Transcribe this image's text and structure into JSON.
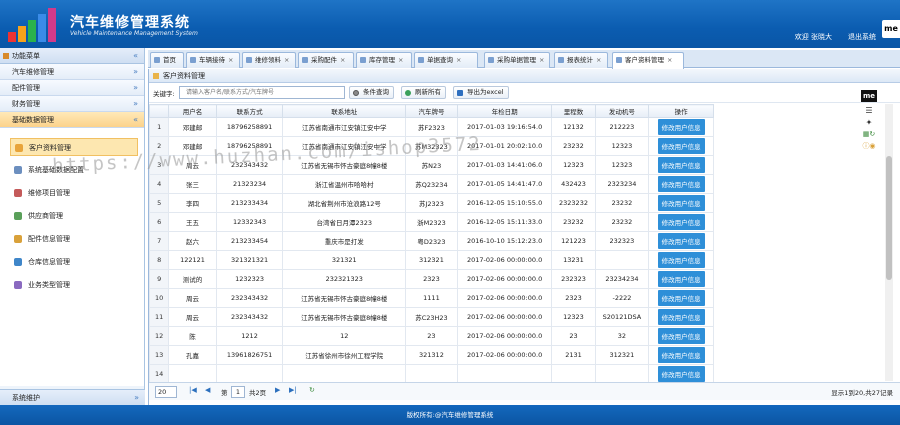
{
  "app": {
    "title": "汽车维修管理系统",
    "subtitle": "Vehicle Maintenance Management System",
    "welcome": "欢迎 张晓大",
    "logout": "退出系统",
    "badge": "me"
  },
  "sidebar": {
    "menu_title": "功能菜单",
    "groups": [
      {
        "label": "汽车维修管理"
      },
      {
        "label": "配件管理"
      },
      {
        "label": "财务管理"
      },
      {
        "label": "基础数据管理"
      }
    ],
    "items": [
      {
        "label": "客户资料管理"
      },
      {
        "label": "系统基础数据配置"
      },
      {
        "label": "维修项目管理"
      },
      {
        "label": "供应商管理"
      },
      {
        "label": "配件信息管理"
      },
      {
        "label": "仓库信息管理"
      },
      {
        "label": "业务类型管理"
      }
    ],
    "bottom": "系统维护"
  },
  "tabs": [
    {
      "label": "首页"
    },
    {
      "label": "车辆接待"
    },
    {
      "label": "维修领料"
    },
    {
      "label": "采购配件"
    },
    {
      "label": "库存管理"
    },
    {
      "label": "单据查询"
    },
    {
      "label": "采购单据管理"
    },
    {
      "label": "报表统计"
    },
    {
      "label": "客户资料管理"
    }
  ],
  "panel": {
    "title": "客户资料管理",
    "keyword_label": "关键字:",
    "keyword_placeholder": "请输入客户名/联系方式/汽车牌号",
    "btn_search": "条件查询",
    "btn_refresh": "刷新所有",
    "btn_export": "导出为excel"
  },
  "table": {
    "headers": [
      "",
      "用户名",
      "联系方式",
      "联系地址",
      "汽车牌号",
      "年检日期",
      "里程数",
      "发动机号",
      "操作"
    ],
    "action_label": "修改用户信息",
    "rows": [
      [
        "1",
        "邓建邮",
        "18796258891",
        "江苏省南通市江安镇江安中学",
        "苏F2323",
        "2017-01-03 19:16:54.0",
        "12132",
        "212223"
      ],
      [
        "2",
        "邓建邮",
        "18796258891",
        "江苏省南通市江安镇江安中学",
        "苏M32323",
        "2017-01-01 20:02:10.0",
        "23232",
        "12323"
      ],
      [
        "3",
        "周云",
        "232343432",
        "江苏省无锡市怀古豪庭8幢8楼",
        "苏N23",
        "2017-01-03 14:41:06.0",
        "12323",
        "12323"
      ],
      [
        "4",
        "张三",
        "21323234",
        "浙江省温州市哈哈村",
        "苏Q23234",
        "2017-01-05 14:41:47.0",
        "432423",
        "2323234"
      ],
      [
        "5",
        "李四",
        "213233434",
        "湖北省荆州市沧浪路12号",
        "苏J2323",
        "2016-12-05 15:10:55.0",
        "2323232",
        "23232"
      ],
      [
        "6",
        "王五",
        "12332343",
        "台湾省日月潭2323",
        "浙M2323",
        "2016-12-05 15:11:33.0",
        "23232",
        "23232"
      ],
      [
        "7",
        "赵六",
        "213233454",
        "重庆市是打发",
        "粤D2323",
        "2016-10-10 15:12:23.0",
        "121223",
        "232323"
      ],
      [
        "8",
        "122121",
        "321321321",
        "321321",
        "312321",
        "2017-02-06 00:00:00.0",
        "13231",
        ""
      ],
      [
        "9",
        "测试的",
        "1232323",
        "232321323",
        "2323",
        "2017-02-06 00:00:00.0",
        "232323",
        "23234234"
      ],
      [
        "10",
        "周云",
        "232343432",
        "江苏省无锡市怀古豪庭8幢8楼",
        "1111",
        "2017-02-06 00:00:00.0",
        "2323",
        "-2222"
      ],
      [
        "11",
        "周云",
        "232343432",
        "江苏省无锡市怀古豪庭8幢8楼",
        "苏C23H23",
        "2017-02-06 00:00:00.0",
        "12323",
        "S20121DSA"
      ],
      [
        "12",
        "陈",
        "1212",
        "12",
        "23",
        "2017-02-06 00:00:00.0",
        "23",
        "32"
      ],
      [
        "13",
        "孔嘉",
        "13961826751",
        "江苏省徐州市徐州工程学院",
        "321312",
        "2017-02-06 00:00:00.0",
        "2131",
        "312321"
      ],
      [
        "14",
        "",
        "",
        "",
        "",
        "",
        "",
        ""
      ]
    ]
  },
  "pager": {
    "page_size": "20",
    "page_label": "第",
    "page_value": "1",
    "total_pages": "共2页",
    "info": "显示1到20,共27记录"
  },
  "watermark": "https://www.huzhan.com/ishop3572",
  "footer": "版权所有:@汽车维修管理系统",
  "colors": {
    "header": "#0b5cb0",
    "action_button": "#2e8fd8",
    "active_menu": "#fde7b0"
  }
}
